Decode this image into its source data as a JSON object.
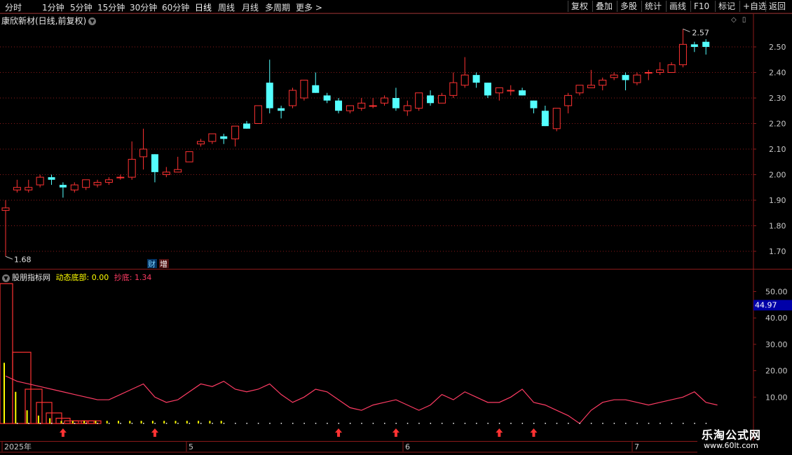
{
  "toolbar": {
    "timeframes": [
      "分时",
      "1分钟",
      "5分钟",
      "15分钟",
      "30分钟",
      "60分钟",
      "日线",
      "周线",
      "月线",
      "多周期",
      "更多 >"
    ],
    "active_timeframe": "日线",
    "right_buttons": [
      "复权",
      "叠加",
      "多股",
      "统计",
      "画线",
      "F10",
      "标记",
      "+自选",
      "返回"
    ]
  },
  "main_chart": {
    "title": "康欣新材(日线,前复权)",
    "price_ticks": [
      "2.50",
      "2.40",
      "2.30",
      "2.20",
      "2.10",
      "2.00",
      "1.90",
      "1.80",
      "1.70"
    ],
    "high_label": "2.57",
    "low_label": "1.68",
    "badges": [
      "财",
      "增"
    ]
  },
  "indicator": {
    "name": "股朋指标网",
    "line1_label": "动态底部:",
    "line1_value": "0.00",
    "line2_label": "抄底:",
    "line2_value": "1.34",
    "axis_ticks": [
      "50.00",
      "40.00",
      "30.00",
      "20.00",
      "10.00"
    ],
    "current_value": "44.97"
  },
  "date_axis": [
    "2025年",
    "5",
    "6",
    "7"
  ],
  "watermark": {
    "text": "乐淘公式网",
    "url": "www.60lt.com"
  },
  "colors": {
    "up": "#ff3232",
    "down": "#54ffff",
    "line": "#ff3c64",
    "yellow": "#ffff00",
    "grid": "#8b1a1a"
  },
  "chart_data": {
    "type": "candlestick",
    "columns": [
      "open",
      "high",
      "low",
      "close"
    ],
    "candles": [
      [
        1.86,
        1.9,
        1.68,
        1.87
      ],
      [
        1.94,
        1.98,
        1.93,
        1.95
      ],
      [
        1.94,
        1.98,
        1.93,
        1.95
      ],
      [
        1.96,
        2.0,
        1.95,
        1.99
      ],
      [
        1.99,
        2.0,
        1.96,
        1.98
      ],
      [
        1.96,
        1.97,
        1.91,
        1.95
      ],
      [
        1.94,
        1.97,
        1.93,
        1.96
      ],
      [
        1.95,
        1.98,
        1.94,
        1.98
      ],
      [
        1.96,
        1.98,
        1.95,
        1.97
      ],
      [
        1.97,
        1.99,
        1.96,
        1.98
      ],
      [
        1.99,
        2.0,
        1.98,
        1.99
      ],
      [
        1.99,
        2.13,
        1.98,
        2.06
      ],
      [
        2.07,
        2.18,
        2.02,
        2.1
      ],
      [
        2.08,
        2.08,
        1.97,
        2.01
      ],
      [
        2.0,
        2.03,
        1.99,
        2.01
      ],
      [
        2.01,
        2.07,
        2.01,
        2.02
      ],
      [
        2.05,
        2.08,
        2.05,
        2.09
      ],
      [
        2.12,
        2.14,
        2.11,
        2.13
      ],
      [
        2.13,
        2.16,
        2.12,
        2.16
      ],
      [
        2.15,
        2.16,
        2.12,
        2.14
      ],
      [
        2.14,
        2.19,
        2.11,
        2.19
      ],
      [
        2.2,
        2.21,
        2.18,
        2.18
      ],
      [
        2.2,
        2.27,
        2.2,
        2.27
      ],
      [
        2.36,
        2.45,
        2.24,
        2.26
      ],
      [
        2.26,
        2.27,
        2.22,
        2.25
      ],
      [
        2.27,
        2.34,
        2.26,
        2.33
      ],
      [
        2.3,
        2.37,
        2.29,
        2.37
      ],
      [
        2.35,
        2.4,
        2.32,
        2.32
      ],
      [
        2.31,
        2.32,
        2.28,
        2.29
      ],
      [
        2.29,
        2.3,
        2.24,
        2.25
      ],
      [
        2.25,
        2.27,
        2.24,
        2.27
      ],
      [
        2.26,
        2.3,
        2.25,
        2.28
      ],
      [
        2.27,
        2.3,
        2.26,
        2.27
      ],
      [
        2.28,
        2.31,
        2.27,
        2.3
      ],
      [
        2.3,
        2.34,
        2.25,
        2.26
      ],
      [
        2.25,
        2.29,
        2.23,
        2.27
      ],
      [
        2.26,
        2.32,
        2.25,
        2.32
      ],
      [
        2.31,
        2.33,
        2.27,
        2.28
      ],
      [
        2.28,
        2.32,
        2.28,
        2.31
      ],
      [
        2.31,
        2.4,
        2.3,
        2.36
      ],
      [
        2.35,
        2.46,
        2.34,
        2.39
      ],
      [
        2.39,
        2.4,
        2.34,
        2.36
      ],
      [
        2.36,
        2.36,
        2.3,
        2.31
      ],
      [
        2.32,
        2.34,
        2.29,
        2.34
      ],
      [
        2.33,
        2.35,
        2.31,
        2.33
      ],
      [
        2.33,
        2.34,
        2.31,
        2.31
      ],
      [
        2.29,
        2.29,
        2.24,
        2.26
      ],
      [
        2.25,
        2.27,
        2.19,
        2.19
      ],
      [
        2.18,
        2.25,
        2.17,
        2.26
      ],
      [
        2.27,
        2.32,
        2.24,
        2.31
      ],
      [
        2.32,
        2.34,
        2.31,
        2.35
      ],
      [
        2.34,
        2.41,
        2.34,
        2.35
      ],
      [
        2.35,
        2.38,
        2.33,
        2.37
      ],
      [
        2.38,
        2.4,
        2.37,
        2.39
      ],
      [
        2.39,
        2.4,
        2.33,
        2.37
      ],
      [
        2.36,
        2.4,
        2.35,
        2.39
      ],
      [
        2.4,
        2.41,
        2.37,
        2.4
      ],
      [
        2.4,
        2.44,
        2.39,
        2.41
      ],
      [
        2.4,
        2.44,
        2.4,
        2.43
      ],
      [
        2.43,
        2.57,
        2.42,
        2.51
      ],
      [
        2.51,
        2.52,
        2.48,
        2.5
      ],
      [
        2.52,
        2.53,
        2.47,
        2.5
      ]
    ],
    "indicator_line": [
      18,
      16,
      15,
      14,
      13,
      12,
      11,
      10,
      9,
      9,
      11,
      13,
      15,
      10,
      8,
      9,
      12,
      15,
      14,
      16,
      13,
      12,
      13,
      15,
      11,
      8,
      10,
      13,
      12,
      9,
      6,
      5,
      7,
      8,
      9,
      7,
      5,
      7,
      11,
      9,
      12,
      10,
      8,
      8,
      10,
      13,
      8,
      7,
      5,
      3,
      0,
      5,
      8,
      9,
      9,
      8,
      7,
      8,
      9,
      10,
      12,
      8,
      7
    ],
    "indicator_ticks": [
      1,
      2,
      3,
      4,
      5,
      6,
      7,
      8,
      9,
      10,
      11,
      12,
      13,
      14,
      15,
      16,
      17,
      18,
      19,
      20,
      21,
      22,
      23,
      24,
      25,
      26,
      27,
      28,
      29,
      30,
      31,
      32,
      33,
      34,
      35,
      36,
      37,
      38,
      39,
      40,
      41,
      42,
      43,
      44,
      45,
      46,
      47,
      48,
      49,
      50,
      51,
      52,
      53,
      54,
      55,
      56,
      57,
      58,
      59,
      60,
      61
    ],
    "yellow_bars": [
      23,
      12,
      5,
      3,
      2,
      1,
      1,
      1,
      1,
      1,
      1,
      1,
      1,
      1,
      1,
      1,
      1,
      1,
      1,
      1
    ],
    "red_boxes": [
      53,
      27,
      13,
      8,
      4,
      2,
      1,
      1,
      1,
      1
    ],
    "buy_arrows": [
      5,
      13,
      29,
      34,
      43,
      46
    ],
    "ylim_price": [
      1.65,
      2.58
    ],
    "ylim_indicator": [
      0,
      53
    ]
  }
}
